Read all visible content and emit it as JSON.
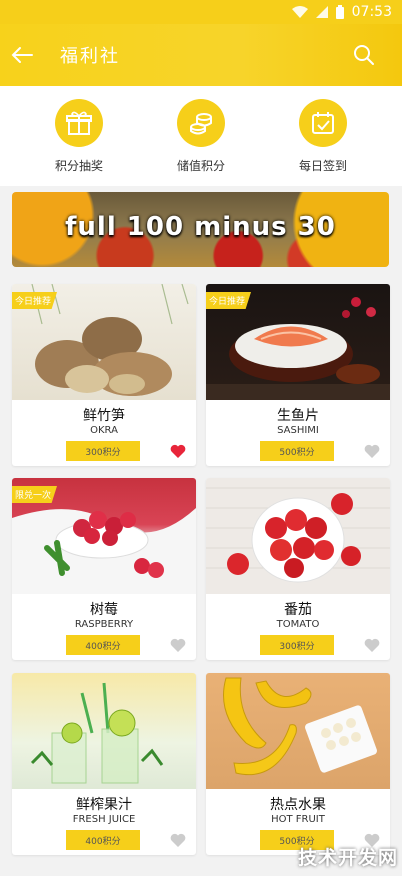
{
  "status_bar": {
    "time": "07:53"
  },
  "header": {
    "title": "福利社"
  },
  "features": [
    {
      "label": "积分抽奖",
      "icon": "gift-icon"
    },
    {
      "label": "储值积分",
      "icon": "coins-icon"
    },
    {
      "label": "每日签到",
      "icon": "calendar-check-icon"
    }
  ],
  "banner": {
    "text": "full 100 minus 30"
  },
  "products": [
    {
      "name": "鲜竹笋",
      "en": "OKRA",
      "price": "300积分",
      "tag": "今日推荐",
      "favorited": true,
      "image": "bamboo-shoot-image"
    },
    {
      "name": "生鱼片",
      "en": "SASHIMI",
      "price": "500积分",
      "tag": "今日推荐",
      "favorited": false,
      "image": "sashimi-image"
    },
    {
      "name": "树莓",
      "en": "RASPBERRY",
      "price": "400积分",
      "tag": "限兑一次",
      "favorited": false,
      "image": "raspberry-image"
    },
    {
      "name": "番茄",
      "en": "TOMATO",
      "price": "300积分",
      "tag": "",
      "favorited": false,
      "image": "tomato-image"
    },
    {
      "name": "鲜榨果汁",
      "en": "FRESH JUICE",
      "price": "400积分",
      "tag": "",
      "favorited": false,
      "image": "juice-image"
    },
    {
      "name": "热点水果",
      "en": "HOT FRUIT",
      "price": "500积分",
      "tag": "",
      "favorited": false,
      "image": "banana-image"
    }
  ],
  "watermark": "技术开发网",
  "colors": {
    "accent": "#f6cf1a",
    "heart_active": "#e8253a",
    "heart_inactive": "#cccccc"
  }
}
